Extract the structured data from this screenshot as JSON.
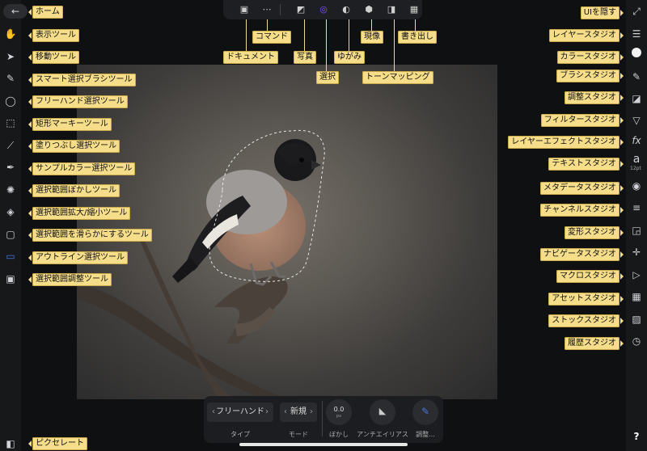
{
  "top": {
    "callouts": {
      "document": "ドキュメント",
      "command": "コマンド",
      "photo": "写真",
      "select": "選択",
      "warp": "ゆがみ",
      "develop": "現像",
      "tone": "トーンマッピング",
      "export": "書き出し"
    }
  },
  "left": {
    "home": "ホーム",
    "tools": [
      "表示ツール",
      "移動ツール",
      "スマート選択ブラシツール",
      "フリーハンド選択ツール",
      "矩形マーキーツール",
      "塗りつぶし選択ツール",
      "サンプルカラー選択ツール",
      "選択範囲ぼかしツール",
      "選択範囲拡大/縮小ツール",
      "選択範囲を滑らかにするツール",
      "アウトライン選択ツール",
      "選択範囲調整ツール"
    ],
    "pixel": "ピクセレート"
  },
  "right": {
    "hide_ui": "UIを隠す",
    "studios": [
      "レイヤースタジオ",
      "カラースタジオ",
      "ブラシスタジオ",
      "調整スタジオ",
      "フィルタースタジオ",
      "レイヤーエフェクトスタジオ",
      "テキストスタジオ",
      "メタデータスタジオ",
      "チャンネルスタジオ",
      "変形スタジオ",
      "ナビゲータスタジオ",
      "マクロスタジオ",
      "アセットスタジオ",
      "ストックスタジオ",
      "履歴スタジオ"
    ],
    "text_size": "12pt",
    "help": "?"
  },
  "context": {
    "type_value": "フリーハンド",
    "type_label": "タイプ",
    "mode_value": "新規",
    "mode_label": "モード",
    "feather_value": "0.0",
    "feather_unit": "px",
    "feather_label": "ぼかし",
    "antialias_label": "アンチエイリアス",
    "refine_label": "調整..."
  },
  "colors": {
    "tooltip": "#f5dd8a",
    "accent": "#4a78d8"
  }
}
